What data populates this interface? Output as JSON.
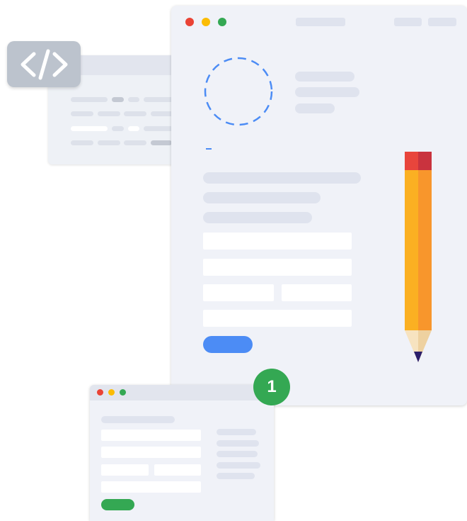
{
  "badge": {
    "step_number": "1"
  },
  "icons": {
    "code": "code-brackets-icon",
    "pencil": "pencil-icon",
    "avatar": "dashed-circle-avatar-icon"
  },
  "colors": {
    "close_dot": "#ea4335",
    "minimize_dot": "#fbbc05",
    "maximize_dot": "#34a853",
    "primary_button": "#4c8cf5",
    "success_button": "#34a853",
    "badge": "#34a853",
    "window_bg": "#f0f2f8",
    "placeholder": "#dfe3ee",
    "code_badge": "#bcc3cd"
  }
}
